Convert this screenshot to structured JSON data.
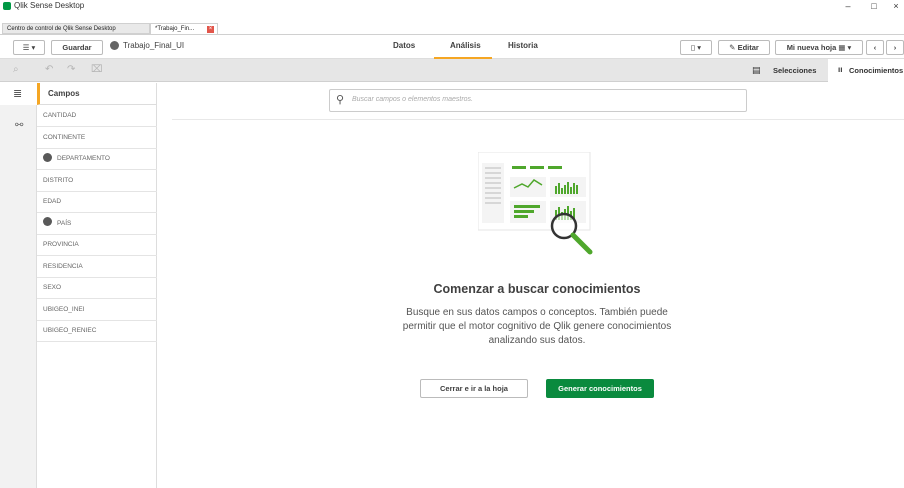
{
  "window": {
    "title": "Qlik Sense Desktop",
    "controls": {
      "minimize": "–",
      "maximize": "□",
      "close": "×"
    }
  },
  "doc_tabs": [
    {
      "label": "Centro de control de Qlik Sense Desktop"
    },
    {
      "label": "*Trabajo_Fin...",
      "close": "×"
    }
  ],
  "toolbar": {
    "menu_icon": "hamburger-icon",
    "save_label": "Guardar",
    "app_name": "Trabajo_Final_UI",
    "nav": [
      "Datos",
      "Análisis",
      "Historia"
    ],
    "active_nav": "Análisis",
    "edit_label": "Editar",
    "sheet_label": "Mi nueva hoja",
    "accent": "#f5a623"
  },
  "toolbar2": {
    "selections_label": "Selecciones",
    "insights_label": "Conocimientos"
  },
  "panel": {
    "header": "Campos",
    "fields": [
      {
        "label": "CANTIDAD",
        "geo": false
      },
      {
        "label": "CONTINENTE",
        "geo": false
      },
      {
        "label": "DEPARTAMENTO",
        "geo": true
      },
      {
        "label": "DISTRITO",
        "geo": false
      },
      {
        "label": "EDAD",
        "geo": false
      },
      {
        "label": "PAÍS",
        "geo": true
      },
      {
        "label": "PROVINCIA",
        "geo": false
      },
      {
        "label": "RESIDENCIA",
        "geo": false
      },
      {
        "label": "SEXO",
        "geo": false
      },
      {
        "label": "UBIGEO_INEI",
        "geo": false
      },
      {
        "label": "UBIGEO_RENIEC",
        "geo": false
      }
    ]
  },
  "main": {
    "search_placeholder": "Buscar campos o elementos maestros.",
    "heading": "Comenzar a buscar conocimientos",
    "description": "Busque en sus datos campos o conceptos. También puede permitir que el motor cognitivo de Qlik genere conocimientos analizando sus datos.",
    "close_button": "Cerrar e ir a la hoja",
    "generate_button": "Generar conocimientos",
    "brand_green": "#0a8a3e"
  }
}
